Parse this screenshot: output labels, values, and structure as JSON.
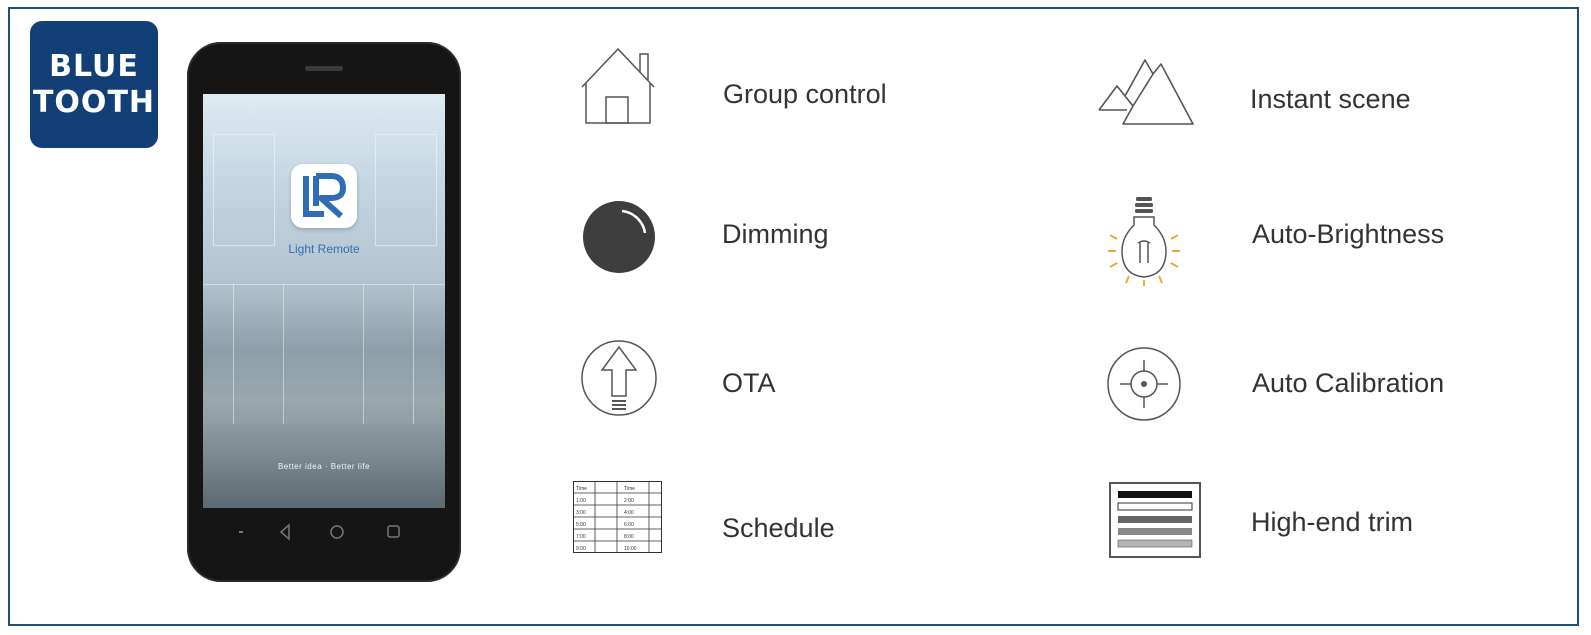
{
  "badge": {
    "line1": "BLUE",
    "line2": "TOOTH"
  },
  "app": {
    "name": "Light Remote",
    "tagline": "Better idea · Better life"
  },
  "features": {
    "group_control": "Group control",
    "dimming": "Dimming",
    "ota": "OTA",
    "schedule": "Schedule",
    "instant_scene": "Instant scene",
    "auto_brightness": "Auto-Brightness",
    "auto_calibration": "Auto Calibration",
    "high_end_trim": "High-end trim"
  },
  "schedule_table": {
    "header": [
      "Time",
      "Time"
    ],
    "left": [
      "1:00",
      "3:00",
      "5:00",
      "7:00",
      "9:00"
    ],
    "right": [
      "2:00",
      "4:00",
      "6:00",
      "8:00",
      "10:00"
    ]
  },
  "colors": {
    "badge": "#123f76",
    "frame": "#1f4e79",
    "icon": "#555555",
    "bulb_rays": "#f2a53a"
  }
}
